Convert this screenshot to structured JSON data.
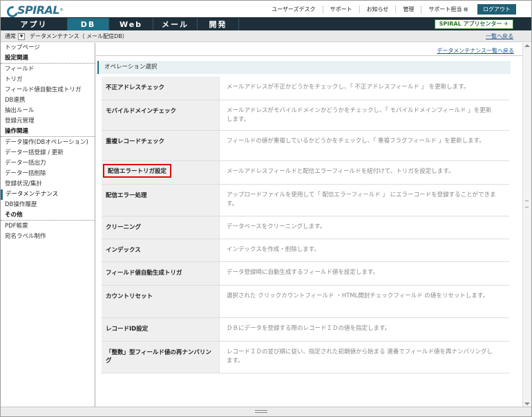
{
  "header": {
    "logo": "SPIRAL",
    "links": [
      "ユーザーズデスク",
      "サポート",
      "お知らせ",
      "管理"
    ],
    "support_person": "サポート担当",
    "support_suffix": "様",
    "logout": "ログアウト"
  },
  "tabs": [
    {
      "label": "アプリ",
      "active": false
    },
    {
      "label": "DB",
      "active": true
    },
    {
      "label": "Web",
      "active": false
    },
    {
      "label": "メール",
      "active": false
    },
    {
      "label": "開発",
      "active": false
    }
  ],
  "appcenter": "SPIRAL アプリセンター",
  "crumb": {
    "mode": "通常",
    "path": "データメンテナンス（ メール配信DB）",
    "back": "一覧へ戻る"
  },
  "sidebar": {
    "items": [
      {
        "type": "item",
        "label": "トップページ"
      },
      {
        "type": "section",
        "label": "設定関連"
      },
      {
        "type": "item",
        "label": "フィールド"
      },
      {
        "type": "item",
        "label": "トリガ"
      },
      {
        "type": "item",
        "label": "フィールド値自動生成トリガ"
      },
      {
        "type": "item",
        "label": "DB連携"
      },
      {
        "type": "item",
        "label": "抽出ルール"
      },
      {
        "type": "item",
        "label": "登録元管理"
      },
      {
        "type": "section",
        "label": "操作関連"
      },
      {
        "type": "item",
        "label": "データ操作(DBオペレーション)"
      },
      {
        "type": "item",
        "label": "データ一括登録 / 更新"
      },
      {
        "type": "item",
        "label": "データ一括出力"
      },
      {
        "type": "item",
        "label": "データ一括削除"
      },
      {
        "type": "item",
        "label": "登録状況/集計"
      },
      {
        "type": "item",
        "label": "データメンテナンス",
        "current": true
      },
      {
        "type": "item",
        "label": "DB操作履歴"
      },
      {
        "type": "section",
        "label": "その他"
      },
      {
        "type": "item",
        "label": "PDF帳票"
      },
      {
        "type": "item",
        "label": "宛名ラベル制作"
      }
    ]
  },
  "main": {
    "list_link": "データメンテナンス一覧へ戻る",
    "section_title": "オペレーション選択",
    "operations": [
      {
        "label": "不正アドレスチェック",
        "desc": "メールアドレスが不正かどうかをチェックし、「 不正アドレスフィールド 」 を更新します。",
        "h": 34
      },
      {
        "label": "モバイルドメインチェック",
        "desc": "メールアドレスがモバイルドメインかどうかをチェックし、「 モバイルドメインフィールド 」を更新します。",
        "h": 44
      },
      {
        "label": "重複レコードチェック",
        "desc": "フィールドの値が重複しているかどうかをチェックし、「 重複フラグフィールド 」を更新します。",
        "h": 44
      },
      {
        "label": "配信エラートリガ設定",
        "desc": "メールアドレスフィールドと配信エラーフィールドを紐付けて、トリガを設定します。",
        "h": 34,
        "highlight": true
      },
      {
        "label": "配信エラー処理",
        "desc": "アップロードファイルを使用して「 配信エラーフィールド 」 にエラーコードを登録することができます。",
        "h": 46
      },
      {
        "label": "クリーニング",
        "desc": "データベースをクリーニングします。",
        "h": 33
      },
      {
        "label": "インデックス",
        "desc": "インデックスを作成・削除します。",
        "h": 33
      },
      {
        "label": "フィールド値自動生成トリガ",
        "desc": "データ登録時に自動生成するフィールド値を設定します。",
        "h": 34
      },
      {
        "label": "カウントリセット",
        "desc": "選択された クリックカウントフィールド ・HTML開封チェックフィールド の値をリセットします。",
        "h": 47
      },
      {
        "label": "レコードID設定",
        "desc": "ＤＢにデータを登録する際のレコードＩＤの値を指定します。",
        "h": 34
      },
      {
        "label": "「整数」型フィールド値の再ナンバリング",
        "desc": "レコードＩＤの並び順に従い、指定された初期値から始まる 連番でフィールド値を再ナンバリングします。",
        "h": 46
      }
    ]
  }
}
